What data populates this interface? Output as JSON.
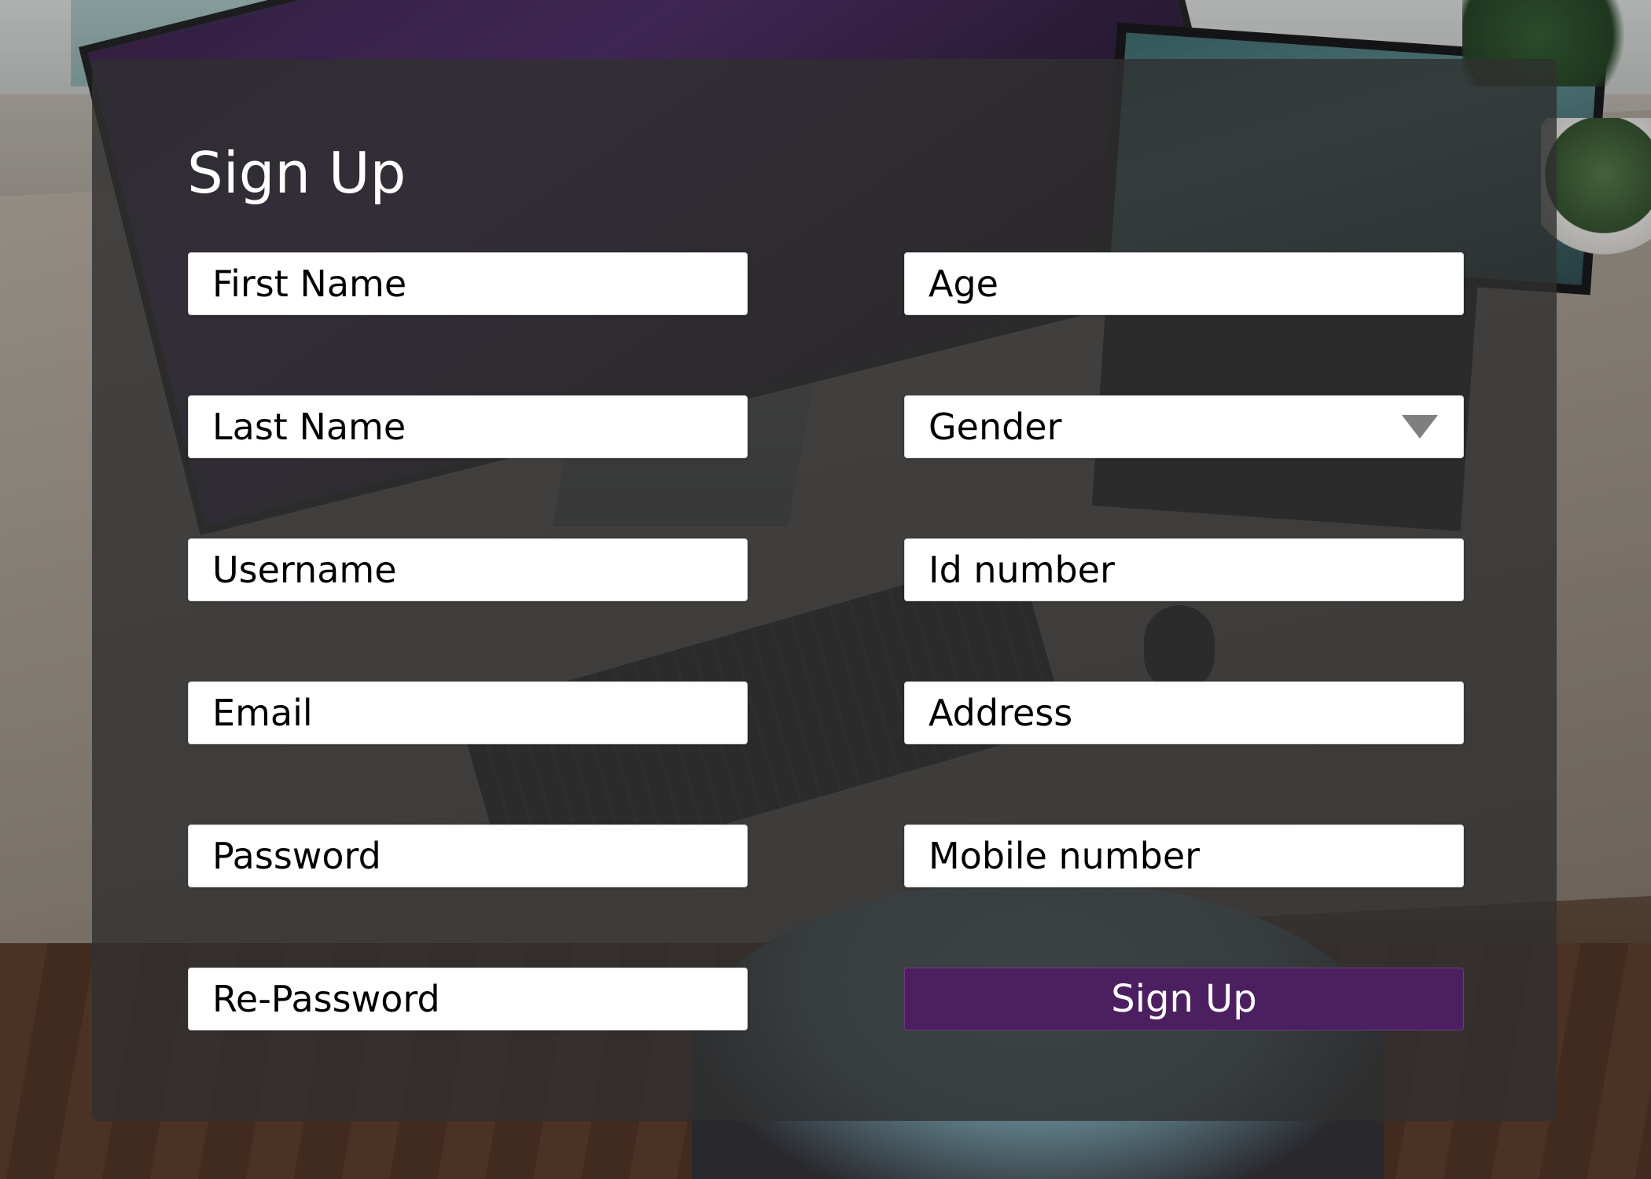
{
  "form": {
    "title": "Sign Up",
    "fields": {
      "first_name": {
        "placeholder": "First Name"
      },
      "last_name": {
        "placeholder": "Last Name"
      },
      "username": {
        "placeholder": "Username"
      },
      "email": {
        "placeholder": "Email"
      },
      "password": {
        "placeholder": "Password"
      },
      "re_password": {
        "placeholder": "Re-Password"
      },
      "age": {
        "placeholder": "Age"
      },
      "gender": {
        "selected": "Gender"
      },
      "id_number": {
        "placeholder": "Id number"
      },
      "address": {
        "placeholder": "Address"
      },
      "mobile_number": {
        "placeholder": "Mobile number"
      }
    },
    "submit_label": "Sign Up"
  },
  "colors": {
    "panel_bg": "#303030",
    "submit_bg": "#4c2060",
    "field_bg": "#ffffff",
    "title_text": "#ffffff"
  },
  "icons": {
    "gender_dropdown": "chevron-down-icon"
  }
}
